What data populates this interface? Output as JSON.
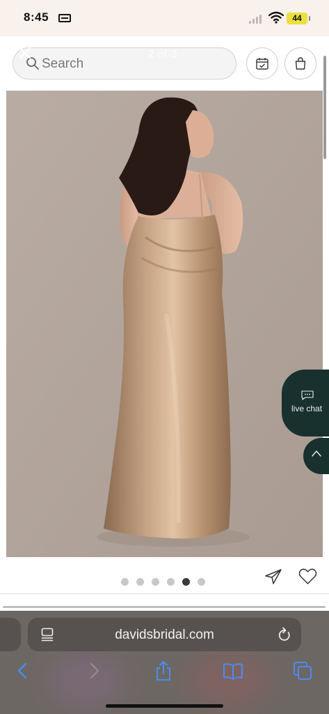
{
  "status_bar": {
    "time": "8:45",
    "battery": "44"
  },
  "header": {
    "search_placeholder": "Search",
    "image_counter": "2 of 3"
  },
  "gallery": {
    "dot_count": 6,
    "active_dot": 5
  },
  "live_chat": {
    "label": "live chat"
  },
  "browser": {
    "url": "davidsbridal.com"
  },
  "colors": {
    "chat_bg": "#18312e",
    "image_bg": "#b4a69c",
    "toolbar_bg": "#6d6763",
    "safari_blue": "#4a8cf0"
  },
  "icons": [
    "close-icon",
    "search-icon",
    "calendar-check-icon",
    "shopping-bag-icon",
    "chat-bubble-icon",
    "chevron-up-icon",
    "share-icon",
    "heart-icon",
    "page-icon",
    "reload-icon",
    "back-icon",
    "forward-icon",
    "share-upload-icon",
    "bookmarks-icon",
    "tabs-icon"
  ]
}
